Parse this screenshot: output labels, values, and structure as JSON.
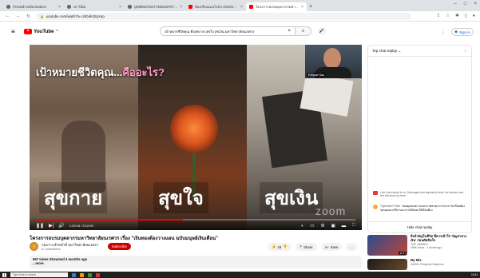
{
  "browser": {
    "tabs": [
      {
        "title": "Firewall Authentication",
        "icon": "globe-icon",
        "active": false
      },
      {
        "title": "xn--l3ba",
        "icon": "globe-icon",
        "active": false
      },
      {
        "title": "Q8985872847749812879761",
        "icon": "globe-icon",
        "active": false
      },
      {
        "title": "ห้องเรียนออนไลน์ฯ 2019/2020 - Yo",
        "icon": "youtube-icon",
        "active": false
      },
      {
        "title": "โครงการอบรมบุคลากรมหาวิทยาลัย",
        "icon": "youtube-icon",
        "active": true
      }
    ],
    "new_tab": "+",
    "url": "youtube.com/watch?v=1Kb4k1ByXqo"
  },
  "youtube": {
    "logo_text": "YouTube",
    "logo_suffix": "TH",
    "search_value": "เป้าหมายชีวิตคุณ คือสุขกาย สุขใจ สุขเงิน มหาวิทยาลัยนเรศวร",
    "signin": "Sign in"
  },
  "video": {
    "headline_prefix": "เป้าหมายชีวิตคุณ...",
    "headline_accent": "คืออะไร?",
    "words": [
      "สุขกาย",
      "สุขใจ",
      "สุขเงิน"
    ],
    "watermark": "zoom",
    "cam_name": "Kittipat Sas",
    "time": "1:29:04 / 3:12:09",
    "progress": 0.46
  },
  "info": {
    "title": "โครงการอบรมบุคลากรมหาวิทยาลัยนเรศวร เรื่อง \"เงินทองต้องวางแผน ฉบับมนุษย์เงินเดือน\"",
    "channel": "กองการเจ้าหน้าที่ มหาวิทยาลัยนเรศวร",
    "subs": "67 subscribers",
    "subscribe": "Subscribe",
    "likes": "18",
    "share": "Share",
    "save": "Save",
    "more": "...",
    "views": "567 views  Streamed 4 months ago",
    "show_more": "...more"
  },
  "chat": {
    "header": "Top chat replay",
    "note": "Live chat replay is on. Messages that appeared when the stream was live will show up here.",
    "msg_author": "Tigerwitten Pake",
    "msg_text": "ขอบคุณบทความและภาพสวยมาก พวกเรานักเรียนต้องขอบคุณมากที่ท่านอาจารย์ได้ออกให้มีเงินดีนะ",
    "hide": "Hide chat replay"
  },
  "recommendations": [
    {
      "title": "สิ่งสำคัญในชีวิต ที่ควรเข้าใจ 'ปัญหาทางเงิน' ก่อนตัดสินใจ",
      "channel": "THE LIBRARY",
      "meta": "155K views · 1 month ago",
      "duration": "20:17"
    },
    {
      "title": "My Mix",
      "channel": "Kitt%N, Penguins Stadiums",
      "meta": "",
      "duration": ""
    }
  ],
  "taskbar": {
    "search": "Type here to search",
    "clock": "10:31"
  },
  "colors": {
    "yt_red": "#ff0000",
    "subscribe_red": "#cc0000",
    "link_blue": "#065fd4",
    "accent_pink": "#ff9ec7"
  }
}
